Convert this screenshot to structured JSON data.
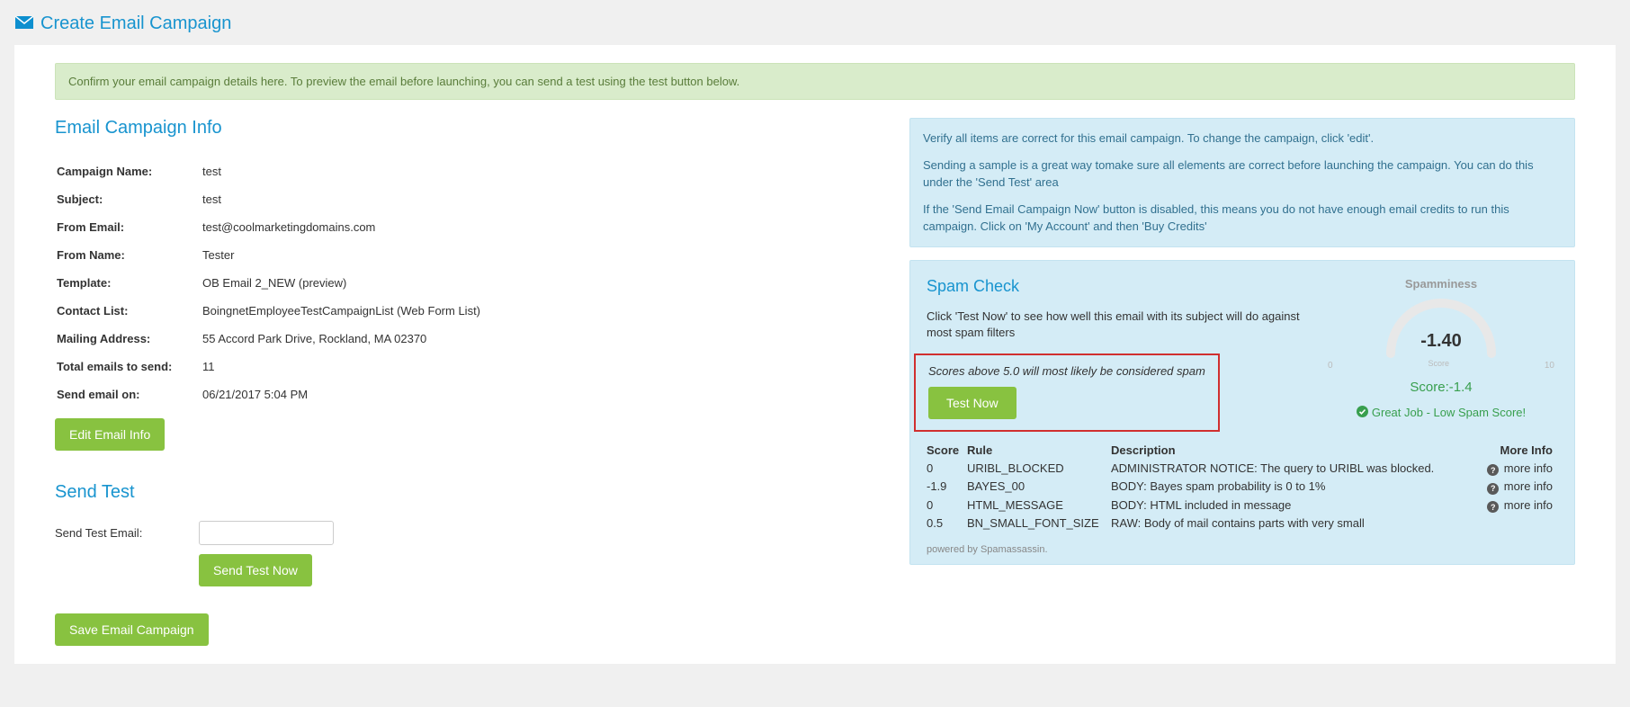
{
  "page_title": "Create Email Campaign",
  "confirm_alert": "Confirm your email campaign details here. To preview the email before launching, you can send a test using the test button below.",
  "sections": {
    "campaign_info_title": "Email Campaign Info",
    "send_test_title": "Send Test",
    "spam_check_title": "Spam Check"
  },
  "campaign": {
    "labels": {
      "name": "Campaign Name:",
      "subject": "Subject:",
      "from_email": "From Email:",
      "from_name": "From Name:",
      "template": "Template:",
      "contact_list": "Contact List:",
      "mailing_address": "Mailing Address:",
      "total_emails": "Total emails to send:",
      "send_on": "Send email on:"
    },
    "values": {
      "name": "test",
      "subject": "test",
      "from_email": "test@coolmarketingdomains.com",
      "from_name": "Tester",
      "template": "OB Email 2_NEW (preview)",
      "contact_list": "BoingnetEmployeeTestCampaignList (Web Form List)",
      "mailing_address": "55 Accord Park Drive, Rockland, MA 02370",
      "total_emails": "11",
      "send_on": "06/21/2017 5:04 PM"
    }
  },
  "buttons": {
    "edit_email_info": "Edit Email Info",
    "send_test_now": "Send Test Now",
    "save_campaign": "Save Email Campaign",
    "test_now": "Test Now"
  },
  "send_test": {
    "label": "Send Test Email:",
    "value": ""
  },
  "info_panel": {
    "p1": "Verify all items are correct for this email campaign. To change the campaign, click 'edit'.",
    "p2": "Sending a sample is a great way tomake sure all elements are correct before launching the campaign. You can do this under the 'Send Test' area",
    "p3": "If the 'Send Email Campaign Now' button is disabled, this means you do not have enough email credits to run this campaign. Click on 'My Account' and then 'Buy Credits'"
  },
  "spam": {
    "desc": "Click 'Test Now' to see how well this email with its subject will do against most spam filters",
    "italic": "Scores above 5.0 will most likely be considered spam",
    "spamminess_label": "Spamminess",
    "gauge_min": "0",
    "gauge_max": "10",
    "gauge_scorelabel": "Score",
    "gauge_value": "-1.40",
    "score_text": "Score:-1.4",
    "great_job": "Great Job - Low Spam Score!",
    "headers": {
      "score": "Score",
      "rule": "Rule",
      "description": "Description",
      "more_info": "More Info"
    },
    "rows": [
      {
        "score": "0",
        "rule": "URIBL_BLOCKED",
        "desc": "ADMINISTRATOR NOTICE: The query to URIBL was blocked.",
        "more": "more info"
      },
      {
        "score": "-1.9",
        "rule": "BAYES_00",
        "desc": "BODY: Bayes spam probability is 0 to 1%",
        "more": "more info"
      },
      {
        "score": "0",
        "rule": "HTML_MESSAGE",
        "desc": "BODY: HTML included in message",
        "more": "more info"
      },
      {
        "score": "0.5",
        "rule": "BN_SMALL_FONT_SIZE",
        "desc": "RAW: Body of mail contains parts with very small",
        "more": ""
      }
    ],
    "powered_prefix": "powered by ",
    "powered_link": "Spamassassin"
  }
}
